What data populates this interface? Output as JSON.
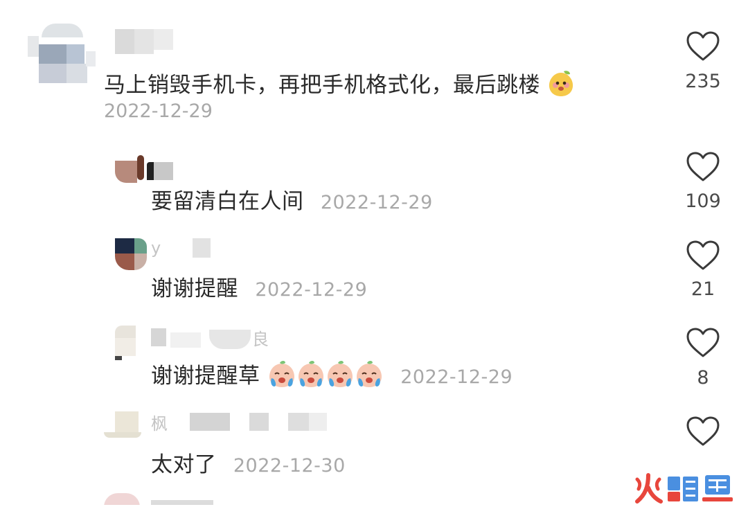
{
  "comments": [
    {
      "text": "马上销毁手机卡，再把手机格式化，最后跳楼",
      "date": "2022-12-29",
      "likes": "235"
    },
    {
      "text": "要留清白在人间",
      "date": "2022-12-29",
      "likes": "109"
    },
    {
      "username_visible": "y",
      "text": "谢谢提醒",
      "date": "2022-12-29",
      "likes": "21"
    },
    {
      "username_visible": "良",
      "text": "谢谢提醒草",
      "date": "2022-12-29",
      "likes": "8"
    },
    {
      "username_visible": "枫",
      "text": "太对了",
      "date": "2022-12-30"
    }
  ],
  "icons": {
    "like": "heart-outline-icon",
    "emoji_main": "mango-face-emoji",
    "emoji_reply": "crying-peach-emoji"
  },
  "watermark": {
    "text": "火鲤鱼",
    "accent": "#e8463c",
    "secondary": "#4a8fe0"
  },
  "colors": {
    "text": "#2a2a2a",
    "date": "#a8a8a8",
    "count": "#4a4a4a",
    "heart_stroke": "#3a3a3a"
  }
}
